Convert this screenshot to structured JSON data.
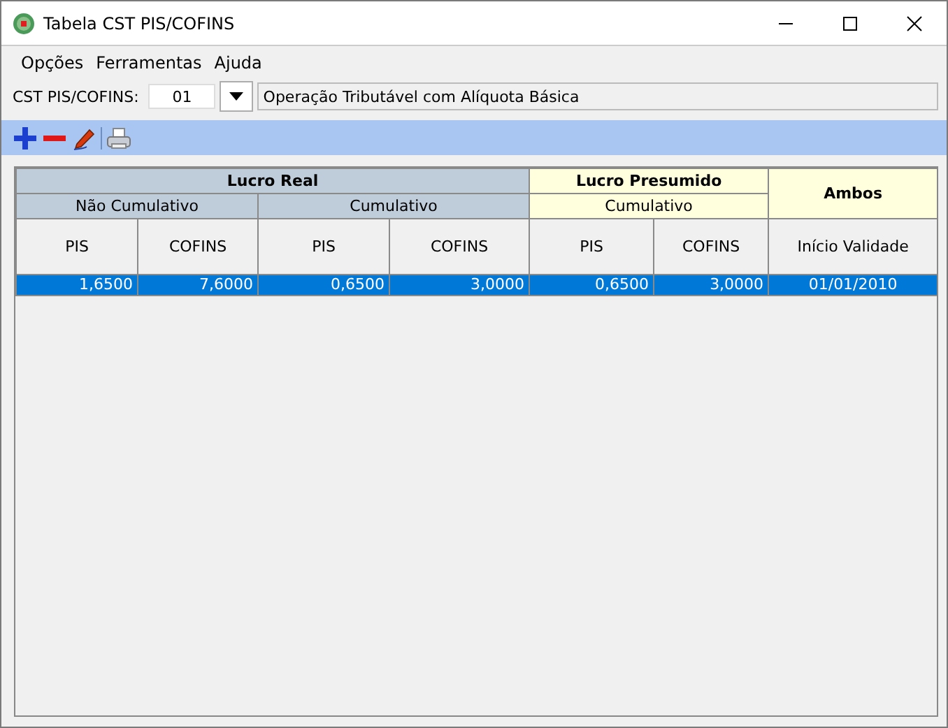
{
  "window": {
    "title": "Tabela CST PIS/COFINS"
  },
  "menu": [
    "Opções",
    "Ferramentas",
    "Ajuda"
  ],
  "cst": {
    "label": "CST PIS/COFINS:",
    "value": "01",
    "description": "Operação Tributável com Alíquota Básica"
  },
  "table": {
    "groups": [
      {
        "label": "Lucro Real",
        "color": "#bfcddb",
        "subgroups": [
          {
            "label": "Não Cumulativo",
            "columns": [
              "PIS",
              "COFINS"
            ]
          },
          {
            "label": "Cumulativo",
            "columns": [
              "PIS",
              "COFINS"
            ]
          }
        ]
      },
      {
        "label": "Lucro Presumido",
        "color": "#ffffde",
        "subgroups": [
          {
            "label": "Cumulativo",
            "columns": [
              "PIS",
              "COFINS"
            ]
          }
        ]
      },
      {
        "label": "Ambos",
        "color": "#ffffde",
        "columns": [
          "Início Validade"
        ]
      }
    ],
    "rows": [
      {
        "selected": true,
        "cells": [
          "1,6500",
          "7,6000",
          "0,6500",
          "3,0000",
          "0,6500",
          "3,0000",
          "01/01/2010"
        ]
      }
    ]
  }
}
